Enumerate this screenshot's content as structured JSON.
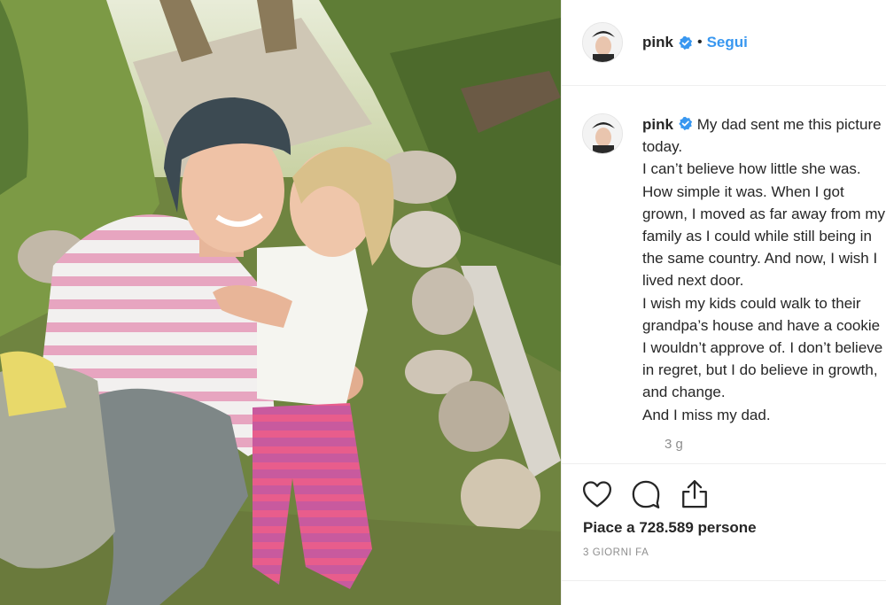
{
  "post": {
    "photo_description_icon": "photo",
    "username": "pink",
    "verified": true,
    "separator": "•",
    "follow_label": "Segui"
  },
  "caption": {
    "username": "pink",
    "text": "My dad sent me this picture today.\nI can’t believe how little she was. How simple it was. When I got grown, I moved as far away from my family as I could while still being in the same country. And now, I wish I lived next door.\nI wish my kids could walk to their grandpa’s house and have a cookie I wouldn’t approve of. I don’t believe in regret, but I do believe in growth, and change.\nAnd I miss my dad.",
    "time_ago": "3 g"
  },
  "actions": {
    "like_icon": "heart-icon",
    "comment_icon": "comment-icon",
    "share_icon": "share-icon"
  },
  "likes_text": "Piace a 728.589 persone",
  "date_text": "3 GIORNI FA",
  "colors": {
    "link": "#3897f0",
    "text": "#262626",
    "muted": "#8e8e8e",
    "border": "#efefef"
  }
}
